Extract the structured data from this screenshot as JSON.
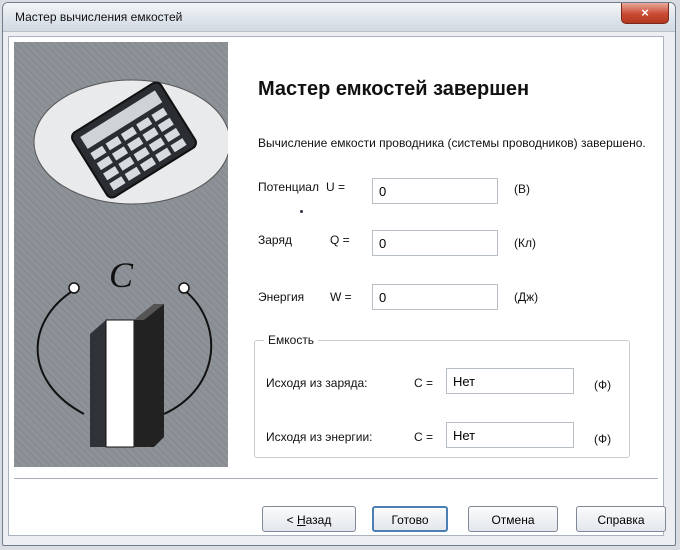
{
  "window": {
    "title": "Мастер вычисления емкостей",
    "close_glyph": "×"
  },
  "page": {
    "heading": "Мастер емкостей завершен",
    "description": "Вычисление емкости проводника (системы проводников) завершено."
  },
  "side_panel": {
    "capacitor_symbol": "C",
    "icons": [
      "calculator-icon",
      "capacitor-icon"
    ]
  },
  "fields": [
    {
      "label": "Потенциал",
      "symbol": "U =",
      "value": "0",
      "unit": "(В)"
    },
    {
      "label": "Заряд",
      "symbol": "Q =",
      "value": "0",
      "unit": "(Кл)"
    },
    {
      "label": "Энергия",
      "symbol": "W =",
      "value": "0",
      "unit": "(Дж)"
    }
  ],
  "capacity_group": {
    "title": "Емкость",
    "rows": [
      {
        "label": "Исходя из заряда:",
        "symbol": "C =",
        "value": "Нет",
        "unit": "(Ф)"
      },
      {
        "label": "Исходя из энергии:",
        "symbol": "C =",
        "value": "Нет",
        "unit": "(Ф)"
      }
    ]
  },
  "buttons": {
    "back_prefix": "< ",
    "back_accel": "Н",
    "back_rest": "азад",
    "finish": "Готово",
    "cancel": "Отмена",
    "help": "Справка"
  },
  "colors": {
    "window_bg": "#eceef1",
    "close_red": "#c94a33",
    "panel_gray": "#8e9399",
    "default_border": "#4c7fb3"
  }
}
